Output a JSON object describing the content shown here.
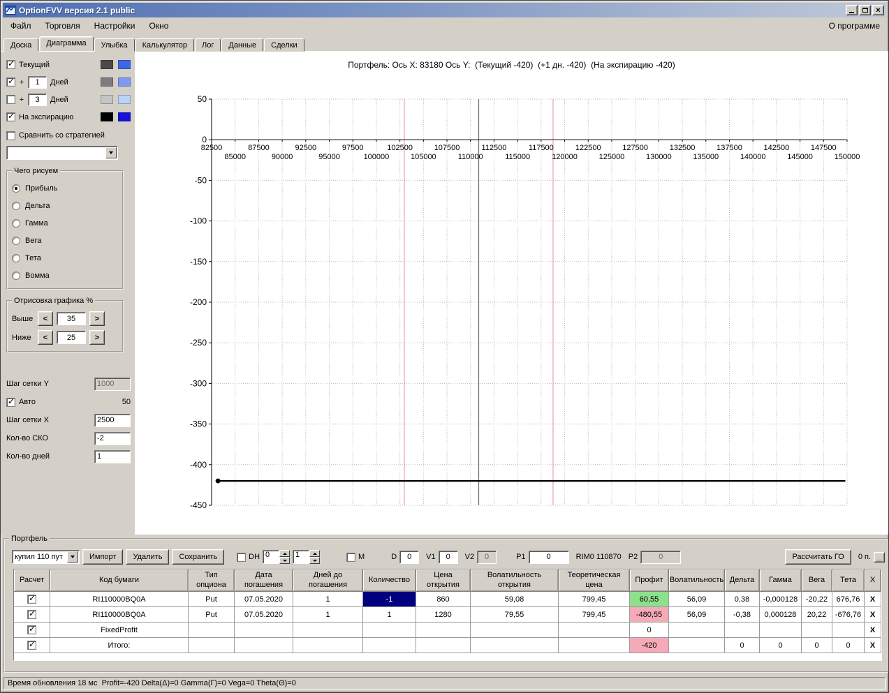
{
  "window": {
    "title": "OptionFVV версия 2.1 public",
    "about": "О программе"
  },
  "menu": [
    "Файл",
    "Торговля",
    "Настройки",
    "Окно"
  ],
  "tabs": [
    {
      "label": "Доска",
      "active": false
    },
    {
      "label": "Диаграмма",
      "active": true
    },
    {
      "label": "Улыбка",
      "active": false
    },
    {
      "label": "Калькулятор",
      "active": false
    },
    {
      "label": "Лог",
      "active": false
    },
    {
      "label": "Данные",
      "active": false
    },
    {
      "label": "Сделки",
      "active": false
    }
  ],
  "sidebar": {
    "series": [
      {
        "label": "Текущий",
        "checked": true,
        "swatch1": "#4a4a4a",
        "swatch2": "#3d67e6"
      },
      {
        "prefix": "+",
        "value": "1",
        "label": "Дней",
        "checked": true,
        "swatch1": "#7d7d7d",
        "swatch2": "#7e9aee"
      },
      {
        "prefix": "+",
        "value": "3",
        "label": "Дней",
        "checked": false,
        "swatch1": "#c4c4c4",
        "swatch2": "#bad4f6"
      },
      {
        "label": "На экспирацию",
        "checked": true,
        "swatch1": "#000000",
        "swatch2": "#1612d6"
      }
    ],
    "compare_label": "Сравнить со стратегией",
    "compare_checked": false,
    "strategy_value": "",
    "draw_group": {
      "title": "Чего рисуем",
      "options": [
        "Прибыль",
        "Дельта",
        "Гамма",
        "Вега",
        "Тета",
        "Вомма"
      ],
      "selected": 0
    },
    "render_group": {
      "title": "Отрисовка графика %",
      "rows": [
        {
          "label": "Выше",
          "value": "35"
        },
        {
          "label": "Ниже",
          "value": "25"
        }
      ]
    },
    "fields": {
      "grid_y": {
        "label": "Шаг сетки Y",
        "value": "1000"
      },
      "auto": {
        "label": "Авто",
        "checked": true,
        "value": "50"
      },
      "grid_x": {
        "label": "Шаг сетки X",
        "value": "2500"
      },
      "sko": {
        "label": "Кол-во СКО",
        "value": "-2"
      },
      "days": {
        "label": "Кол-во дней",
        "value": "1"
      }
    }
  },
  "chart_data": {
    "type": "line",
    "title": "Портфель: Ось X: 83180 Ось Y:  (Текущий -420)  (+1 дн. -420)  (На экспирацию -420)",
    "xlim": [
      82500,
      150000
    ],
    "ylim": [
      -450,
      50
    ],
    "x_tick_step": 2500,
    "y_ticks": [
      50,
      0,
      -50,
      -100,
      -150,
      -200,
      -250,
      -300,
      -350,
      -400,
      -450
    ],
    "x_label_rows": [
      [
        82500,
        87500,
        92500,
        97500,
        102500,
        107500,
        112500,
        117500,
        122500,
        127500,
        132500,
        137500,
        142500,
        147500
      ],
      [
        85000,
        90000,
        95000,
        100000,
        105000,
        110000,
        115000,
        120000,
        125000,
        130000,
        135000,
        140000,
        145000,
        150000
      ]
    ],
    "grid": true,
    "vlines": [
      {
        "x": 102970,
        "color": "#f0a6b2",
        "name": "sko-lower-line"
      },
      {
        "x": 110870,
        "color": "#70707e",
        "name": "current-price-line"
      },
      {
        "x": 118770,
        "color": "#f0a6b2",
        "name": "sko-upper-line"
      }
    ],
    "series": [
      {
        "name": "Текущий",
        "color": "#000000",
        "x": [
          83180,
          149800
        ],
        "y": [
          -420,
          -420
        ]
      },
      {
        "name": "+1 дн.",
        "color": "#000000",
        "x": [
          83180,
          149800
        ],
        "y": [
          -420,
          -420
        ]
      },
      {
        "name": "На экспирацию",
        "color": "#000000",
        "x": [
          83180,
          149800
        ],
        "y": [
          -420,
          -420
        ]
      }
    ],
    "marker": {
      "x": 83180,
      "y": -420
    }
  },
  "portfolio": {
    "group_title": "Портфель",
    "toolbar": {
      "strategy_select": "купил 110 пут",
      "import_label": "Импорт",
      "delete_label": "Удалить",
      "save_label": "Сохранить",
      "dh_label": "DH",
      "dh_checked": false,
      "dh_spin1": "0",
      "dh_spin2": "1",
      "m_label": "M",
      "m_checked": false,
      "d_label": "D",
      "d_value": "0",
      "v1_label": "V1",
      "v1_value": "0",
      "v2_label": "V2",
      "v2_value": "0",
      "p1_label": "P1",
      "p1_value": "0",
      "ticker": "RIM0 110870",
      "p2_label": "P2",
      "p2_value": "0",
      "calc_label": "Рассчитать ГО",
      "points_label": "0 п.",
      "minimized_label": "_"
    },
    "table": {
      "headers": [
        "Расчет",
        "Код бумаги",
        "Тип\nопциона",
        "Дата\nпогашения",
        "Дней до\nпогашения",
        "Количество",
        "Цена\nоткрытия",
        "Волатильность\nоткрытия",
        "Теоретическая\nцена",
        "Профит",
        "Волатильность",
        "Дельта",
        "Гамма",
        "Вега",
        "Тета",
        "X"
      ],
      "rows": [
        {
          "checked": true,
          "qty_selected": true,
          "profit_bg": "#8de18d",
          "cells": [
            "",
            "RI110000BQ0A",
            "Put",
            "07.05.2020",
            "1",
            "-1",
            "860",
            "59,08",
            "799,45",
            "60,55",
            "56,09",
            "0,38",
            "-0,000128",
            "-20,22",
            "676,76",
            "X"
          ]
        },
        {
          "checked": true,
          "profit_bg": "#f6aab8",
          "cells": [
            "",
            "RI110000BQ0A",
            "Put",
            "07.05.2020",
            "1",
            "1",
            "1280",
            "79,55",
            "799,45",
            "-480,55",
            "56,09",
            "-0,38",
            "0,000128",
            "20,22",
            "-676,76",
            "X"
          ]
        },
        {
          "checked": true,
          "cells": [
            "",
            "FixedProfit",
            "",
            "",
            "",
            "",
            "",
            "",
            "",
            "0",
            "",
            "",
            "",
            "",
            "",
            "X"
          ]
        },
        {
          "checked": true,
          "profit_bg": "#f6aab8",
          "cells": [
            "",
            "Итого:",
            "",
            "",
            "",
            "",
            "",
            "",
            "",
            "-420",
            "",
            "0",
            "0",
            "0",
            "0",
            "X"
          ]
        }
      ]
    }
  },
  "statusbar": {
    "text": "Время обновления 18 мс  Profit=-420 Delta(Δ)=0 Gamma(Γ)=0 Vega=0 Theta(Θ)=0"
  },
  "colors": {
    "selection": "#000080",
    "profit_positive": "#8de18d",
    "profit_negative": "#f6aab8"
  }
}
